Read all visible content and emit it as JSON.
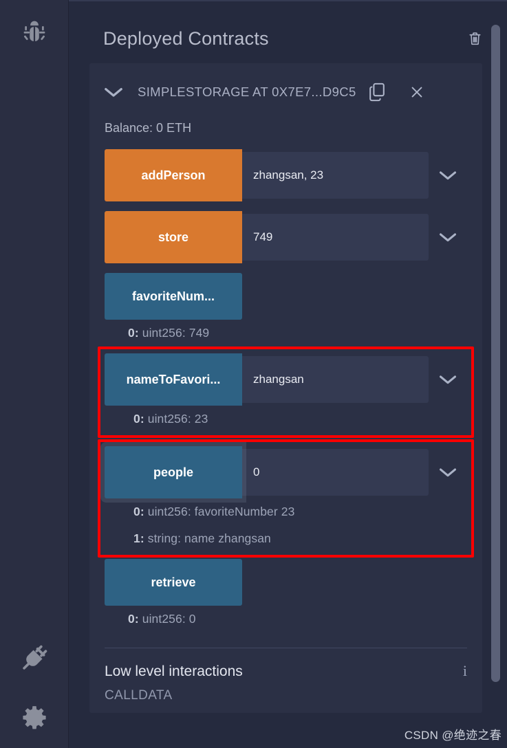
{
  "rail": {
    "icons": [
      {
        "name": "debug-bug-icon",
        "label": "Debugger"
      },
      {
        "name": "plug-icon",
        "label": "Plugin manager"
      },
      {
        "name": "gear-icon",
        "label": "Settings"
      }
    ]
  },
  "panel": {
    "title": "Deployed Contracts",
    "delete_all_label": "Delete all deployed contracts"
  },
  "contract": {
    "title": "SIMPLESTORAGE AT 0X7E7...D9C5",
    "copy_label": "Copy address",
    "close_label": "Remove contract",
    "balance": "Balance: 0 ETH"
  },
  "functions": [
    {
      "name": "addPerson",
      "label": "addPerson",
      "kind": "transact",
      "color": "#d9792f",
      "input_value": "zhangsan, 23",
      "has_input": true,
      "has_expand": true,
      "highlighted": false,
      "focused": false,
      "returns": []
    },
    {
      "name": "store",
      "label": "store",
      "kind": "transact",
      "color": "#d9792f",
      "input_value": "749",
      "has_input": true,
      "has_expand": true,
      "highlighted": false,
      "focused": false,
      "returns": []
    },
    {
      "name": "favoriteNumber",
      "label": "favoriteNum...",
      "kind": "call",
      "color": "#2e6284",
      "input_value": "",
      "has_input": false,
      "has_expand": false,
      "highlighted": false,
      "focused": false,
      "returns": [
        {
          "index": "0:",
          "value": "uint256: 749"
        }
      ]
    },
    {
      "name": "nameToFavoriteNumber",
      "label": "nameToFavori...",
      "kind": "call",
      "color": "#2e6284",
      "input_value": "zhangsan",
      "has_input": true,
      "has_expand": true,
      "highlighted": true,
      "focused": false,
      "returns": [
        {
          "index": "0:",
          "value": "uint256: 23"
        }
      ]
    },
    {
      "name": "people",
      "label": "people",
      "kind": "call",
      "color": "#2e6284",
      "input_value": "0",
      "has_input": true,
      "has_expand": true,
      "highlighted": true,
      "focused": true,
      "returns": [
        {
          "index": "0:",
          "value": "uint256: favoriteNumber 23"
        },
        {
          "index": "1:",
          "value": "string: name zhangsan"
        }
      ]
    },
    {
      "name": "retrieve",
      "label": "retrieve",
      "kind": "call",
      "color": "#2e6284",
      "input_value": "",
      "has_input": false,
      "has_expand": false,
      "highlighted": false,
      "focused": false,
      "returns": [
        {
          "index": "0:",
          "value": "uint256: 0"
        }
      ]
    }
  ],
  "low_level": {
    "heading": "Low level interactions",
    "info_glyph": "i",
    "calldata_label": "CALLDATA"
  },
  "watermark": "CSDN @绝迹之春",
  "colors": {
    "app_background": "#222336",
    "rail_background": "#2a2e42",
    "panel_background": "#252a3e",
    "card_background": "#2b3045",
    "input_background": "#343a52",
    "transact_button": "#d9792f",
    "call_button": "#2e6284",
    "annotation_red": "#fe0000",
    "scrollbar": "#5b6178"
  }
}
